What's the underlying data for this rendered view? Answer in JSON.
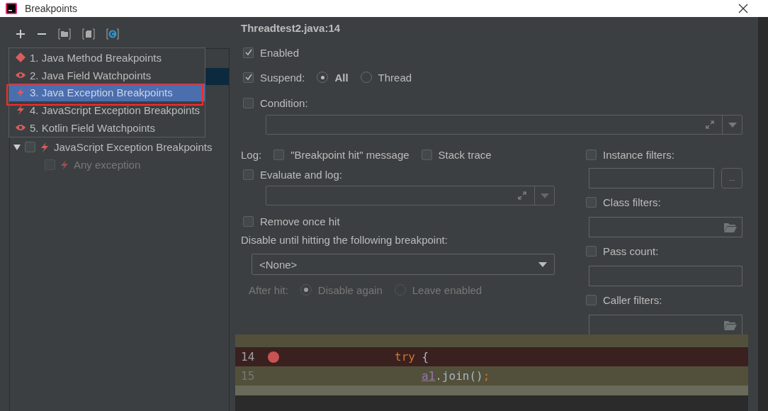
{
  "window": {
    "title": "Breakpoints"
  },
  "add_menu": {
    "items": [
      {
        "label": "1. Java Method Breakpoints",
        "kind": "method",
        "selected": false
      },
      {
        "label": "2. Java Field Watchpoints",
        "kind": "watch",
        "selected": false
      },
      {
        "label": "3. Java Exception Breakpoints",
        "kind": "exception",
        "selected": true
      },
      {
        "label": "4. JavaScript Exception Breakpoints",
        "kind": "exception",
        "selected": false
      },
      {
        "label": "5. Kotlin Field Watchpoints",
        "kind": "watch",
        "selected": false
      }
    ]
  },
  "tree": {
    "items": [
      {
        "label": "JavaScript Exception Breakpoints",
        "kind": "exception",
        "checked": false,
        "expanded": true,
        "disabled": false,
        "children": [
          {
            "label": "Any exception",
            "kind": "exception",
            "checked": false,
            "disabled": true
          }
        ]
      }
    ]
  },
  "details": {
    "title": "Threadtest2.java:14",
    "enabled": {
      "label": "Enabled",
      "checked": true
    },
    "suspend": {
      "label": "Suspend:",
      "checked": true,
      "options": [
        {
          "label": "All",
          "selected": true
        },
        {
          "label": "Thread",
          "selected": false
        }
      ]
    },
    "condition": {
      "label": "Condition:",
      "checked": false
    },
    "log": {
      "label": "Log:",
      "options": [
        {
          "label": "\"Breakpoint hit\" message",
          "checked": false
        },
        {
          "label": "Stack trace",
          "checked": false
        }
      ]
    },
    "evaluate": {
      "label": "Evaluate and log:",
      "checked": false
    },
    "remove_once_hit": {
      "label": "Remove once hit",
      "checked": false
    },
    "disable_until": {
      "label": "Disable until hitting the following breakpoint:",
      "value": "<None>"
    },
    "after_hit": {
      "label": "After hit:",
      "disabled": true,
      "options": [
        {
          "label": "Disable again",
          "selected": true
        },
        {
          "label": "Leave enabled",
          "selected": false
        }
      ]
    }
  },
  "filters": [
    {
      "label": "Instance filters:",
      "checked": false,
      "kind": "browse",
      "button": "..."
    },
    {
      "label": "Class filters:",
      "checked": false,
      "kind": "folder"
    },
    {
      "label": "Pass count:",
      "checked": false,
      "kind": "plain"
    },
    {
      "label": "Caller filters:",
      "checked": false,
      "kind": "folder"
    }
  ],
  "editor": {
    "lines": [
      {
        "number": "14",
        "breakpoint": true,
        "tokens": [
          {
            "text": "try",
            "kind": "keyword"
          },
          {
            "text": " {",
            "kind": "plain"
          }
        ]
      },
      {
        "number": "15",
        "breakpoint": false,
        "tokens": [
          {
            "text": "a1",
            "kind": "field"
          },
          {
            "text": ".join()",
            "kind": "plain"
          },
          {
            "text": ";",
            "kind": "keyword"
          }
        ]
      }
    ]
  }
}
